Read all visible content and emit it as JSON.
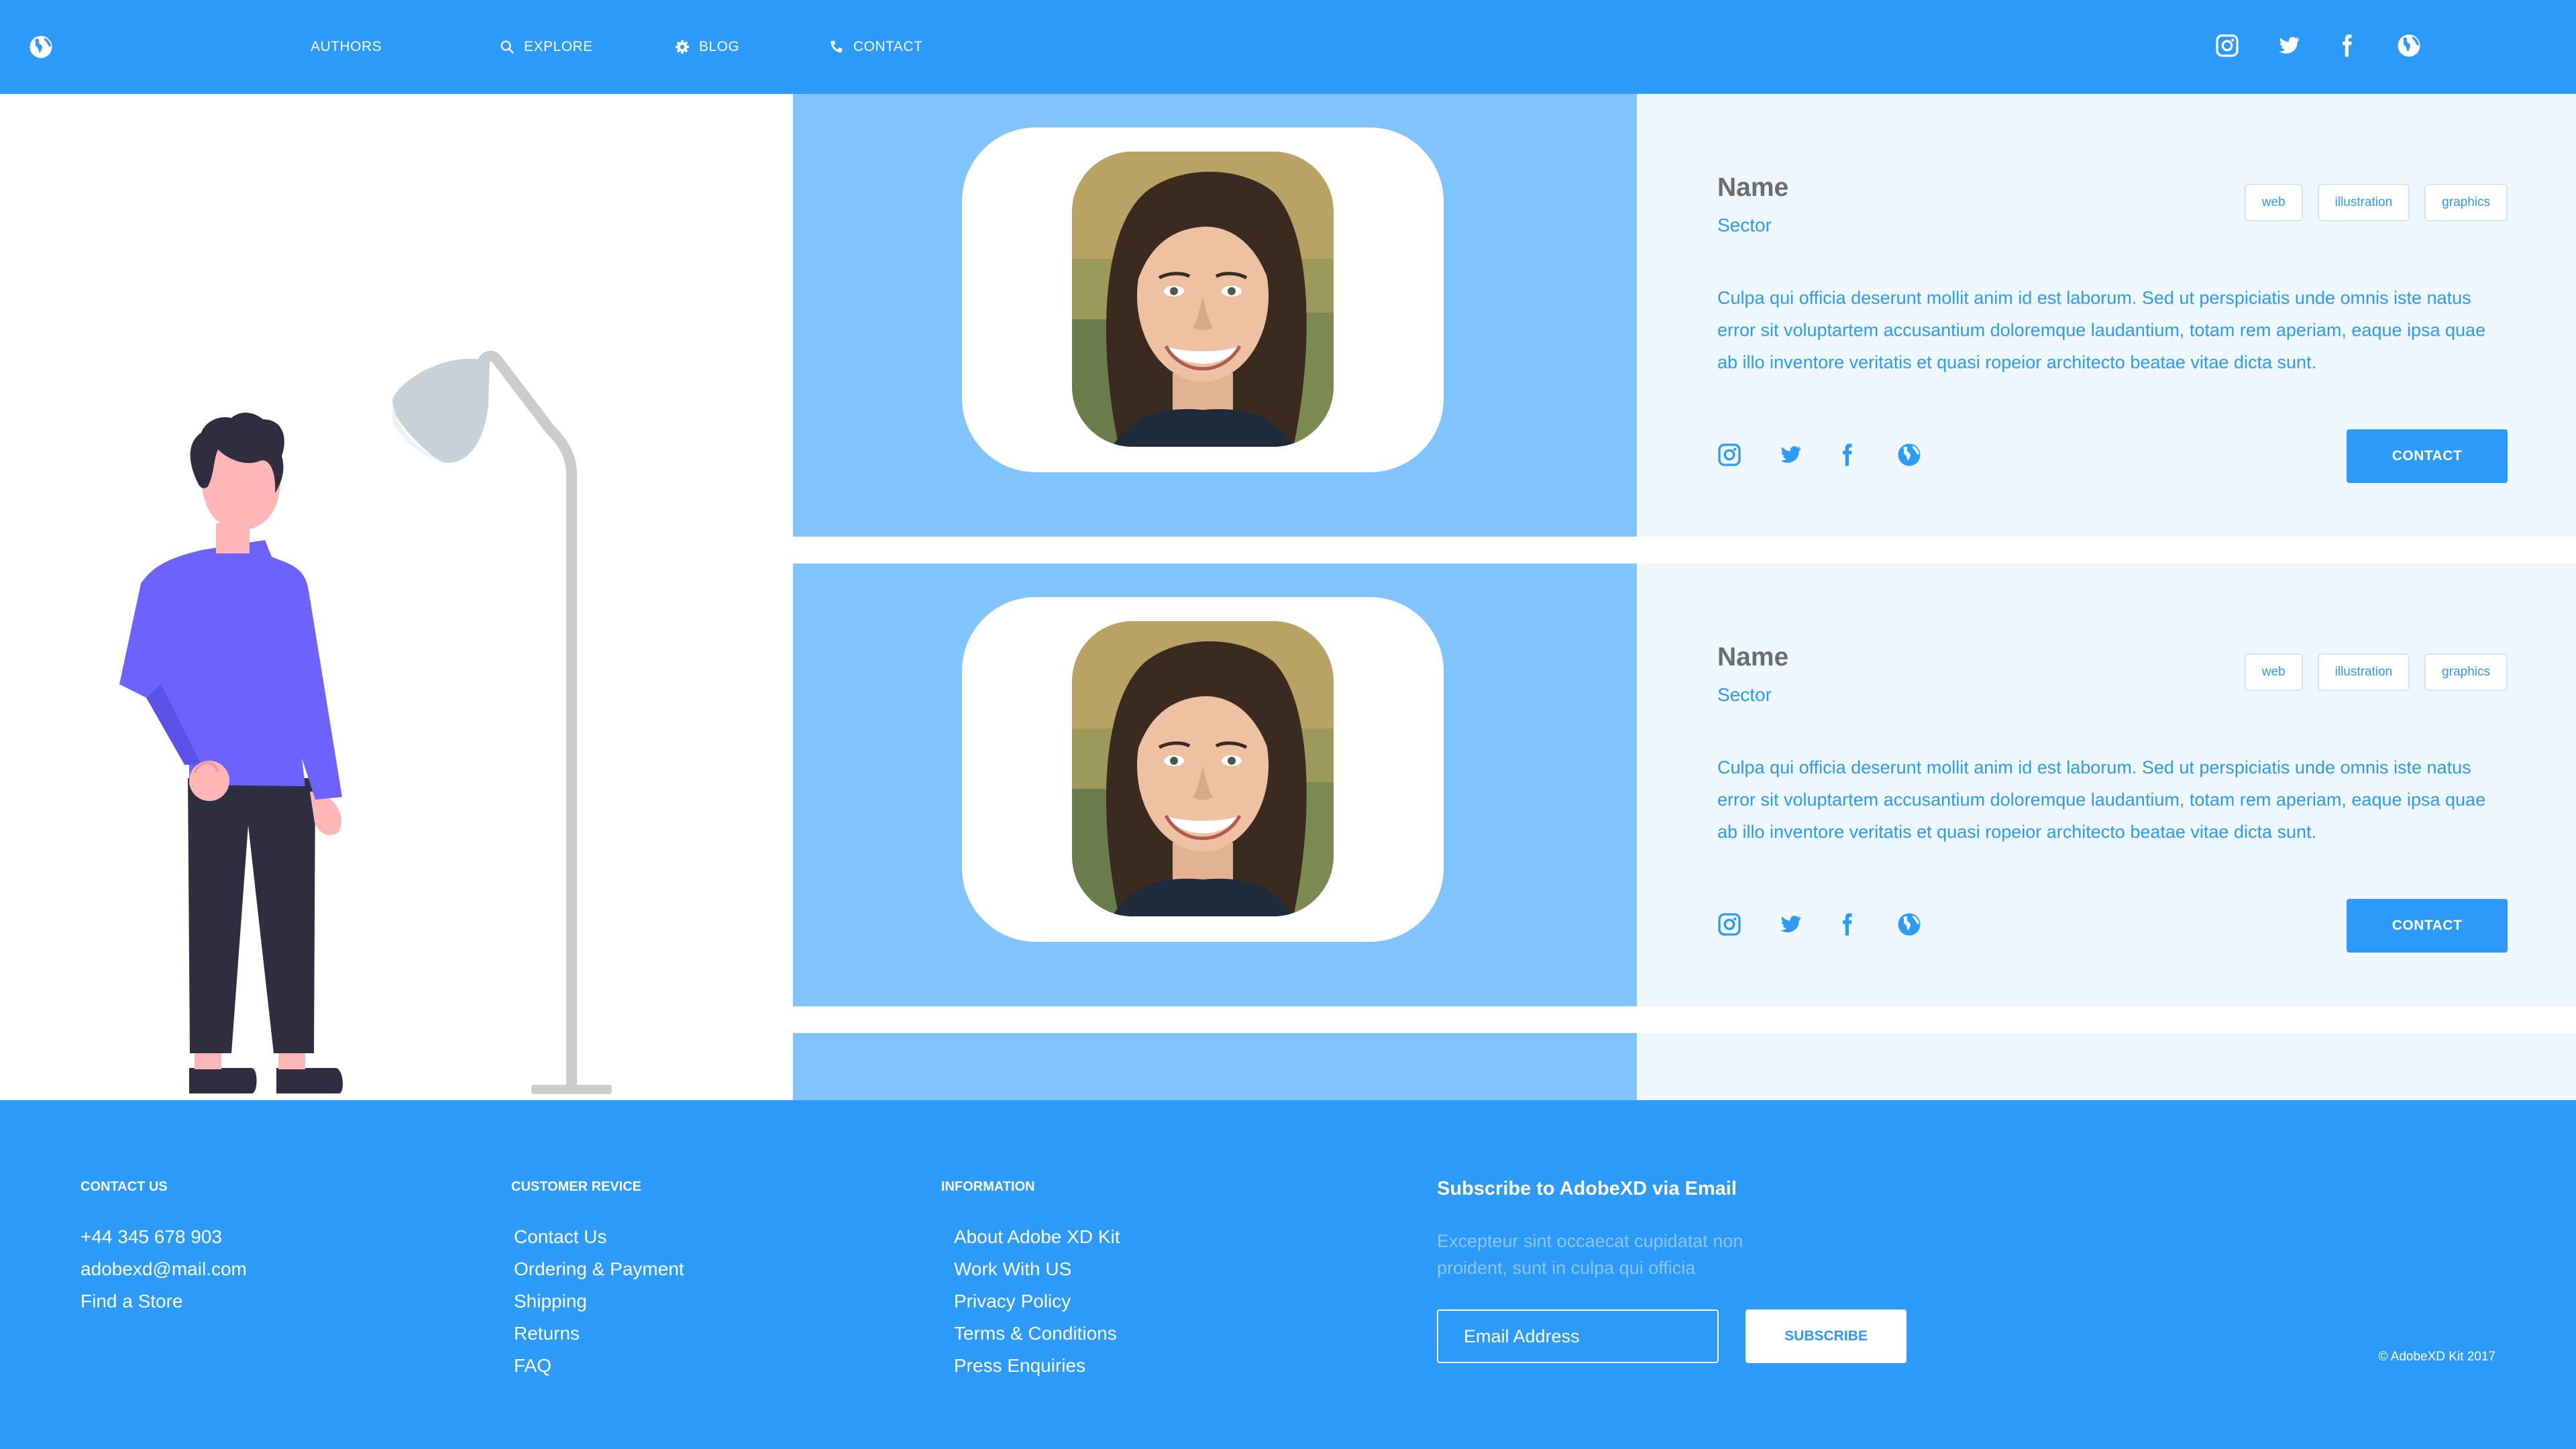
{
  "colors": {
    "primary": "#2b9af9",
    "panel_light_blue": "#80c3fd",
    "panel_pale": "#eff7fe",
    "illustration_shirt": "#6c63ff",
    "illustration_pants": "#2f2e41",
    "illustration_skin": "#ffb6b6",
    "lamp_gray": "#cccccc"
  },
  "header": {
    "logo_icon": "globe-icon",
    "nav": [
      {
        "label": "AUTHORS",
        "icon": ""
      },
      {
        "label": "EXPLORE",
        "icon": "search-icon"
      },
      {
        "label": "BLOG",
        "icon": "gear-icon"
      },
      {
        "label": "CONTACT",
        "icon": "phone-icon"
      }
    ],
    "social_icons": [
      "instagram-icon",
      "twitter-icon",
      "facebook-icon",
      "globe-icon"
    ]
  },
  "profiles": [
    {
      "name": "Name",
      "sector": "Sector",
      "tags": [
        "web",
        "illustration",
        "graphics"
      ],
      "bio": "Culpa qui officia deserunt mollit anim id est laborum. Sed ut perspiciatis unde omnis iste natus error sit voluptartem accusantium doloremque laudantium, totam rem aperiam, eaque ipsa quae ab illo inventore veritatis et quasi ropeior architecto beatae vitae dicta sunt.",
      "contact_label": "CONTACT",
      "social_icons": [
        "instagram-icon",
        "twitter-icon",
        "facebook-icon",
        "globe-icon"
      ]
    },
    {
      "name": "Name",
      "sector": "Sector",
      "tags": [
        "web",
        "illustration",
        "graphics"
      ],
      "bio": "Culpa qui officia deserunt mollit anim id est laborum. Sed ut perspiciatis unde omnis iste natus error sit voluptartem accusantium doloremque laudantium, totam rem aperiam, eaque ipsa quae ab illo inventore veritatis et quasi ropeior architecto beatae vitae dicta sunt.",
      "contact_label": "CONTACT",
      "social_icons": [
        "instagram-icon",
        "twitter-icon",
        "facebook-icon",
        "globe-icon"
      ]
    }
  ],
  "footer": {
    "contact": {
      "heading": "CONTACT US",
      "items": [
        "+44 345 678 903",
        "adobexd@mail.com",
        "Find a Store"
      ]
    },
    "customer_service": {
      "heading": "CUSTOMER REVICE",
      "items": [
        "Contact Us",
        "Ordering & Payment",
        "Shipping",
        "Returns",
        "FAQ"
      ]
    },
    "information": {
      "heading": "INFORMATION",
      "items": [
        "About Adobe XD Kit",
        "Work With US",
        "Privacy Policy",
        "Terms & Conditions",
        "Press Enquiries"
      ]
    },
    "subscribe": {
      "heading": "Subscribe to AdobeXD via Email",
      "text": "Excepteur sint occaecat cupidatat non proident, sunt in culpa qui officia",
      "email_placeholder": "Email Address",
      "button_label": "SUBSCRIBE"
    },
    "copyright": "© AdobeXD Kit 2017"
  }
}
